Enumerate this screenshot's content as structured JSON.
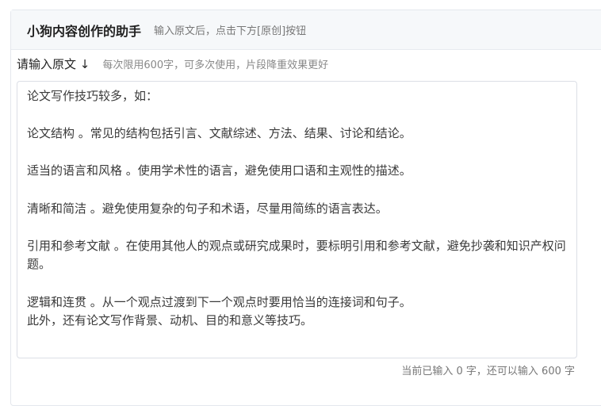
{
  "header": {
    "title": "小狗内容创作的助手",
    "subtitle": "输入原文后，点击下方[原创]按钮"
  },
  "input_section": {
    "label": "请输入原文 ↓",
    "hint": "每次限用600字，可多次使用，片段降重效果更好",
    "value": "论文写作技巧较多，如：\n\n论文结构 。常见的结构包括引言、文献综述、方法、结果、讨论和结论。\n\n适当的语言和风格 。使用学术性的语言，避免使用口语和主观性的描述。\n\n清晰和简洁 。避免使用复杂的句子和术语，尽量用简练的语言表达。\n\n引用和参考文献 。在使用其他人的观点或研究成果时，要标明引用和参考文献，避免抄袭和知识产权问题。\n\n逻辑和连贯 。从一个观点过渡到下一个观点时要用恰当的连接词和句子。\n此外，还有论文写作背景、动机、目的和意义等技巧。"
  },
  "counter": {
    "text": "当前已输入 0 字，还可以输入 600 字"
  }
}
